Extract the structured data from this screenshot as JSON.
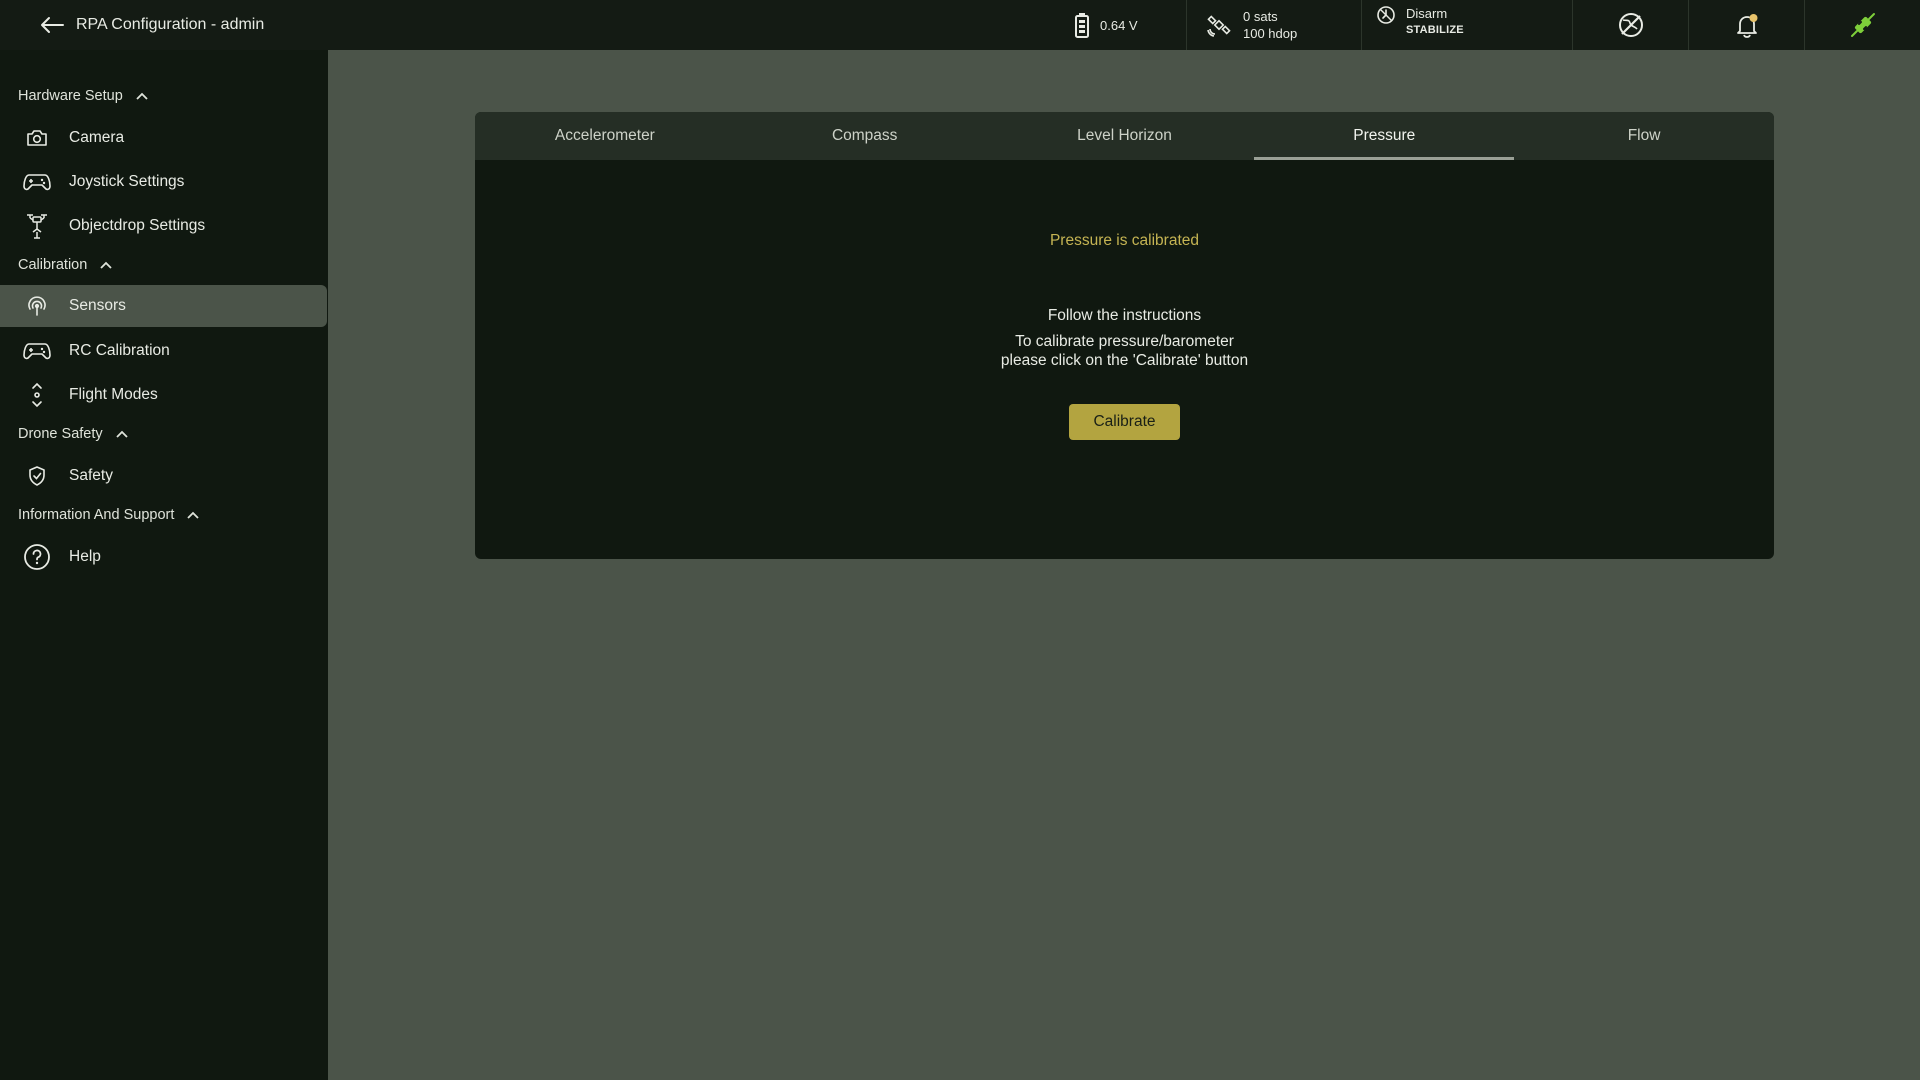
{
  "header": {
    "title": "RPA Configuration - admin",
    "back_icon": "arrow-left-icon",
    "battery": {
      "icon": "battery-icon",
      "voltage": "0.64 V"
    },
    "gps": {
      "icon": "satellite-icon",
      "sats": "0 sats",
      "hdop": "100 hdop"
    },
    "arming": {
      "icon": "arm-status-icon",
      "status": "Disarm",
      "mode": "STABILIZE"
    },
    "icons": [
      "no-gps-icon",
      "bell-icon",
      "plug-connected-icon"
    ],
    "colors": {
      "connected": "#7ecf3a",
      "notification_dot": "#e8c36a"
    }
  },
  "sidebar": {
    "sections": [
      {
        "label": "Hardware Setup",
        "items": [
          {
            "label": "Camera",
            "icon": "camera-icon"
          },
          {
            "label": "Joystick Settings",
            "icon": "gamepad-icon"
          },
          {
            "label": "Objectdrop Settings",
            "icon": "drone-drop-icon"
          }
        ]
      },
      {
        "label": "Calibration",
        "items": [
          {
            "label": "Sensors",
            "icon": "sensor-icon",
            "active": true
          },
          {
            "label": "RC Calibration",
            "icon": "rc-gamepad-icon"
          },
          {
            "label": "Flight Modes",
            "icon": "flight-modes-icon"
          }
        ]
      },
      {
        "label": "Drone Safety",
        "items": [
          {
            "label": "Safety",
            "icon": "shield-icon"
          }
        ]
      },
      {
        "label": "Information And Support",
        "items": [
          {
            "label": "Help",
            "icon": "help-icon"
          }
        ]
      }
    ]
  },
  "main": {
    "tabs": [
      {
        "label": "Accelerometer"
      },
      {
        "label": "Compass"
      },
      {
        "label": "Level Horizon"
      },
      {
        "label": "Pressure",
        "active": true
      },
      {
        "label": "Flow"
      }
    ],
    "status": "Pressure is calibrated",
    "instructions_title": "Follow the instructions",
    "instructions_line1": "To calibrate pressure/barometer",
    "instructions_line2": "please click on the 'Calibrate' button",
    "calibrate_label": "Calibrate"
  },
  "colors": {
    "accent": "#b3a440",
    "status_text": "#c5b453",
    "sidebar_bg": "#101810",
    "content_bg": "#4b5449"
  }
}
